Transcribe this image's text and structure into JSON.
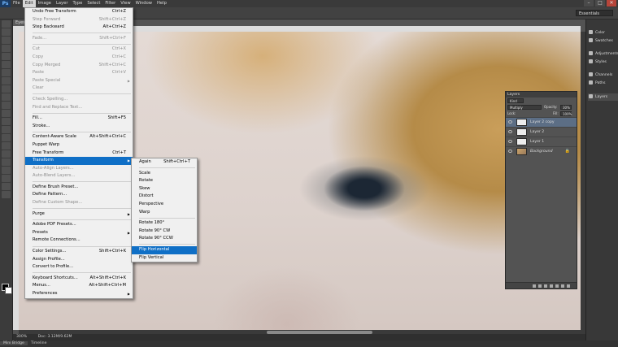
{
  "app": {
    "logo": "Ps"
  },
  "menubar": [
    "File",
    "Edit",
    "Image",
    "Layer",
    "Type",
    "Select",
    "Filter",
    "View",
    "Window",
    "Help"
  ],
  "window_controls": [
    "–",
    "□",
    "✕"
  ],
  "workspace": "Essentials",
  "doc_tab": "Eyes",
  "status": {
    "zoom": "300%",
    "doc": "Doc: 3.12M/9.62M"
  },
  "bottom_tabs": [
    "Mini Bridge",
    "Timeline"
  ],
  "dock": [
    {
      "label": "Color",
      "icon": "color-icon"
    },
    {
      "label": "Swatches",
      "icon": "swatches-icon"
    },
    {
      "label": "Adjustments",
      "icon": "adjustments-icon"
    },
    {
      "label": "Styles",
      "icon": "styles-icon"
    },
    {
      "label": "Channels",
      "icon": "channels-icon"
    },
    {
      "label": "Paths",
      "icon": "paths-icon"
    },
    {
      "label": "Layers",
      "icon": "layers-icon"
    }
  ],
  "layers_panel": {
    "title": "Layers",
    "kind": "Kind",
    "blend_mode": "Multiply",
    "opacity_label": "Opacity:",
    "opacity": "30%",
    "lock_label": "Lock:",
    "fill_label": "Fill:",
    "fill": "100%",
    "layers": [
      {
        "name": "Layer 2 copy",
        "selected": true
      },
      {
        "name": "Layer 2",
        "selected": false
      },
      {
        "name": "Layer 1",
        "selected": false
      },
      {
        "name": "Background",
        "selected": false
      }
    ]
  },
  "edit_menu": [
    {
      "label": "Undo Free Transform",
      "shortcut": "Ctrl+Z"
    },
    {
      "label": "Step Forward",
      "shortcut": "Shift+Ctrl+Z",
      "disabled": true
    },
    {
      "label": "Step Backward",
      "shortcut": "Alt+Ctrl+Z"
    },
    {
      "sep": true
    },
    {
      "label": "Fade...",
      "shortcut": "Shift+Ctrl+F",
      "disabled": true
    },
    {
      "sep": true
    },
    {
      "label": "Cut",
      "shortcut": "Ctrl+X",
      "disabled": true
    },
    {
      "label": "Copy",
      "shortcut": "Ctrl+C",
      "disabled": true
    },
    {
      "label": "Copy Merged",
      "shortcut": "Shift+Ctrl+C",
      "disabled": true
    },
    {
      "label": "Paste",
      "shortcut": "Ctrl+V",
      "disabled": true
    },
    {
      "label": "Paste Special",
      "submenu": true,
      "disabled": true
    },
    {
      "label": "Clear",
      "disabled": true
    },
    {
      "sep": true
    },
    {
      "label": "Check Spelling...",
      "disabled": true
    },
    {
      "label": "Find and Replace Text...",
      "disabled": true
    },
    {
      "sep": true
    },
    {
      "label": "Fill...",
      "shortcut": "Shift+F5"
    },
    {
      "label": "Stroke..."
    },
    {
      "sep": true
    },
    {
      "label": "Content-Aware Scale",
      "shortcut": "Alt+Shift+Ctrl+C"
    },
    {
      "label": "Puppet Warp"
    },
    {
      "label": "Free Transform",
      "shortcut": "Ctrl+T"
    },
    {
      "label": "Transform",
      "submenu": true,
      "highlighted": true
    },
    {
      "label": "Auto-Align Layers...",
      "disabled": true
    },
    {
      "label": "Auto-Blend Layers...",
      "disabled": true
    },
    {
      "sep": true
    },
    {
      "label": "Define Brush Preset..."
    },
    {
      "label": "Define Pattern..."
    },
    {
      "label": "Define Custom Shape...",
      "disabled": true
    },
    {
      "sep": true
    },
    {
      "label": "Purge",
      "submenu": true
    },
    {
      "sep": true
    },
    {
      "label": "Adobe PDF Presets..."
    },
    {
      "label": "Presets",
      "submenu": true
    },
    {
      "label": "Remote Connections..."
    },
    {
      "sep": true
    },
    {
      "label": "Color Settings...",
      "shortcut": "Shift+Ctrl+K"
    },
    {
      "label": "Assign Profile..."
    },
    {
      "label": "Convert to Profile..."
    },
    {
      "sep": true
    },
    {
      "label": "Keyboard Shortcuts...",
      "shortcut": "Alt+Shift+Ctrl+K"
    },
    {
      "label": "Menus...",
      "shortcut": "Alt+Shift+Ctrl+M"
    },
    {
      "label": "Preferences",
      "submenu": true
    }
  ],
  "transform_menu": [
    {
      "label": "Again",
      "shortcut": "Shift+Ctrl+T"
    },
    {
      "sep": true
    },
    {
      "label": "Scale"
    },
    {
      "label": "Rotate"
    },
    {
      "label": "Skew"
    },
    {
      "label": "Distort"
    },
    {
      "label": "Perspective"
    },
    {
      "label": "Warp"
    },
    {
      "sep": true
    },
    {
      "label": "Rotate 180°"
    },
    {
      "label": "Rotate 90° CW"
    },
    {
      "label": "Rotate 90° CCW"
    },
    {
      "sep": true
    },
    {
      "label": "Flip Horizontal",
      "highlighted": true
    },
    {
      "label": "Flip Vertical"
    }
  ]
}
